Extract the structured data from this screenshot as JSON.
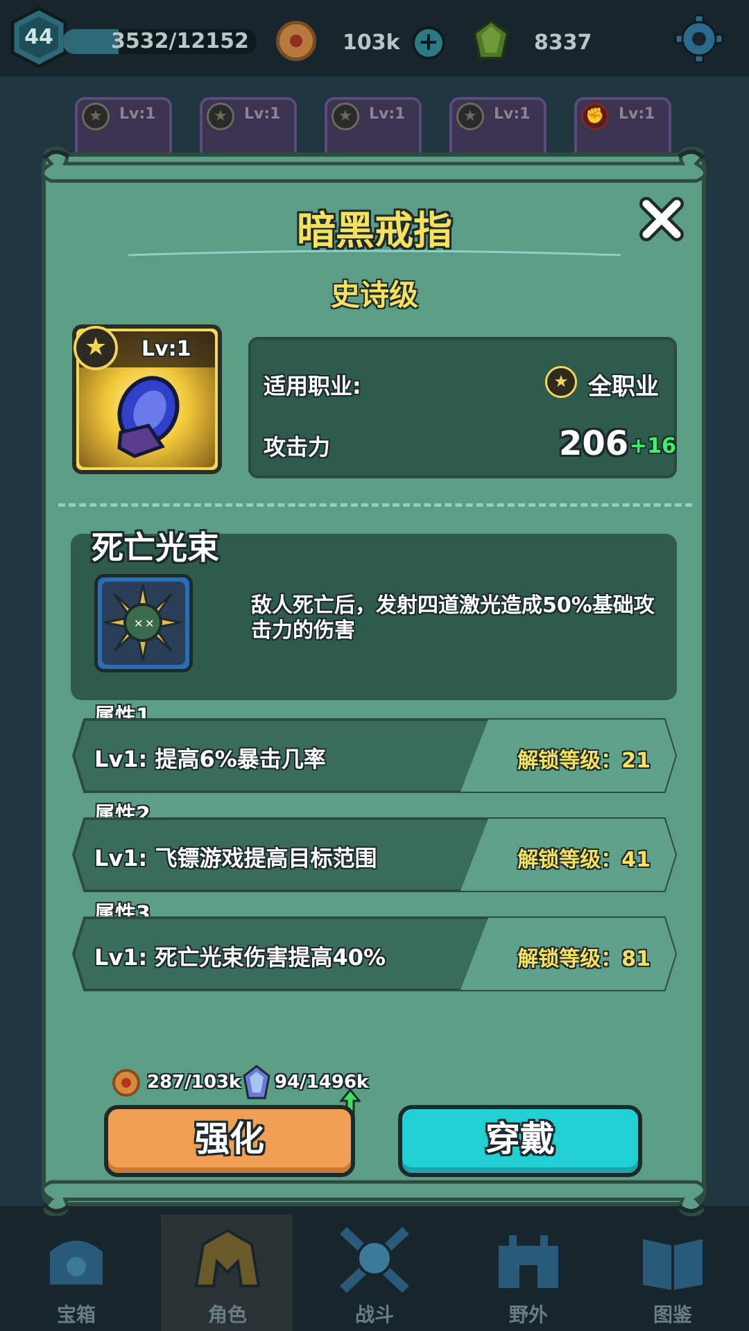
{
  "header": {
    "player_level": "44",
    "xp_text": "3532/12152",
    "xp_progress": 0.29,
    "coins": "103k",
    "gems": "8337"
  },
  "equipment_slots": [
    {
      "level": "Lv:1"
    },
    {
      "level": "Lv:1"
    },
    {
      "level": "Lv:1"
    },
    {
      "level": "Lv:1"
    },
    {
      "level": "Lv:1"
    }
  ],
  "modal": {
    "title": "暗黑戒指",
    "rarity": "史诗级",
    "item_level": "Lv:1",
    "class_label": "适用职业:",
    "class_value": "全职业",
    "attack_label": "攻击力",
    "attack_value": "206",
    "attack_bonus": "+16",
    "skill": {
      "name": "死亡光束",
      "description": "敌人死亡后，发射四道激光造成50%基础攻击力的伤害"
    },
    "attributes": [
      {
        "header": "属性1",
        "text": "Lv1:  提高6%暴击几率",
        "unlock": "解锁等级：21"
      },
      {
        "header": "属性2",
        "text": "Lv1:  飞镖游戏提高目标范围",
        "unlock": "解锁等级：41"
      },
      {
        "header": "属性3",
        "text": "Lv1:  死亡光束伤害提高40%",
        "unlock": "解锁等级：81"
      }
    ],
    "cost_coins": "287/103k",
    "cost_gems": "94/1496k",
    "upgrade_label": "强化",
    "equip_label": "穿戴"
  },
  "nav": [
    {
      "label": "宝箱"
    },
    {
      "label": "角色"
    },
    {
      "label": "战斗"
    },
    {
      "label": "野外"
    },
    {
      "label": "图鉴"
    }
  ],
  "colors": {
    "modal_bg": "#5c9d86",
    "panel_bg": "#2f5b4d",
    "title_yellow": "#f6e15e",
    "bonus_green": "#3ef06a",
    "upgrade_orange": "#f0a055",
    "equip_cyan": "#22d0d4"
  }
}
